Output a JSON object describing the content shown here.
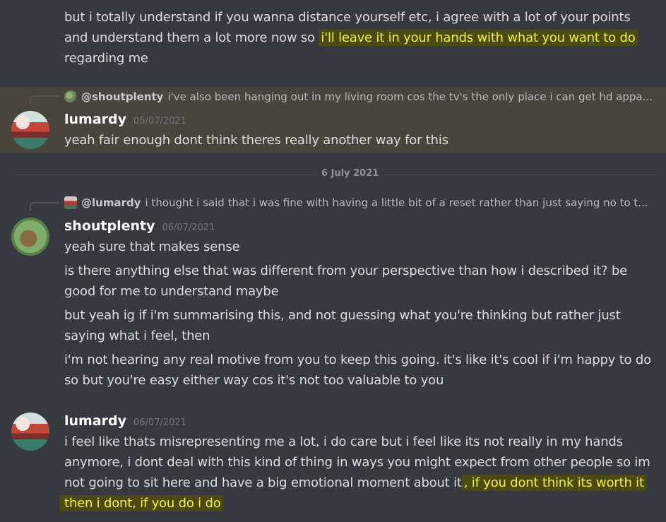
{
  "messages": {
    "m0": {
      "line1": "but i totally understand if you wanna distance yourself etc, i agree with a lot of your points",
      "line2_pre": "and understand them a lot more now so ",
      "line2_hl": "i'll leave it in your hands with what you want to do",
      "line3": "regarding me"
    },
    "m1": {
      "reply_name": "@shoutplenty",
      "reply_text": "i've also been hanging out in my living room cos the tv's the only place i can get hd appa...",
      "username": "lumardy",
      "timestamp": "05/07/2021",
      "text": "yeah fair enough dont think theres really another way for this"
    },
    "divider": "6 July 2021",
    "m2": {
      "reply_name": "@lumardy",
      "reply_text": "i thought i said that i was fine with having a little bit of a reset rather than just saying no to t...",
      "username": "shoutplenty",
      "timestamp": "06/07/2021",
      "lines": [
        "yeah sure that makes sense",
        "is there anything else that was different from your perspective than how i described it? be",
        "good for me to understand maybe",
        "but yeah ig if i'm summarising this, and not guessing what you're thinking but rather just",
        "saying what i feel, then",
        "i'm not hearing any real motive from you to keep this going. it's like it's cool if i'm happy to do",
        "so but you're easy either way cos it's not too valuable to you"
      ]
    },
    "m3": {
      "username": "lumardy",
      "timestamp": "06/07/2021",
      "line1": "i feel like thats misrepresenting me a lot, i do care but i feel like its not really in my hands",
      "line2": "anymore, i dont deal with this kind of thing in ways you might expect from other people so im",
      "line3_pre": "not going to sit here and have a big emotional moment about it",
      "line3_hl": ", if you dont think its worth it",
      "line4_hl": "then i dont, if you do i do"
    }
  },
  "colors": {
    "background": "#36393f",
    "highlight_bg": "#49443c",
    "marker_text": "#f3f33a"
  }
}
